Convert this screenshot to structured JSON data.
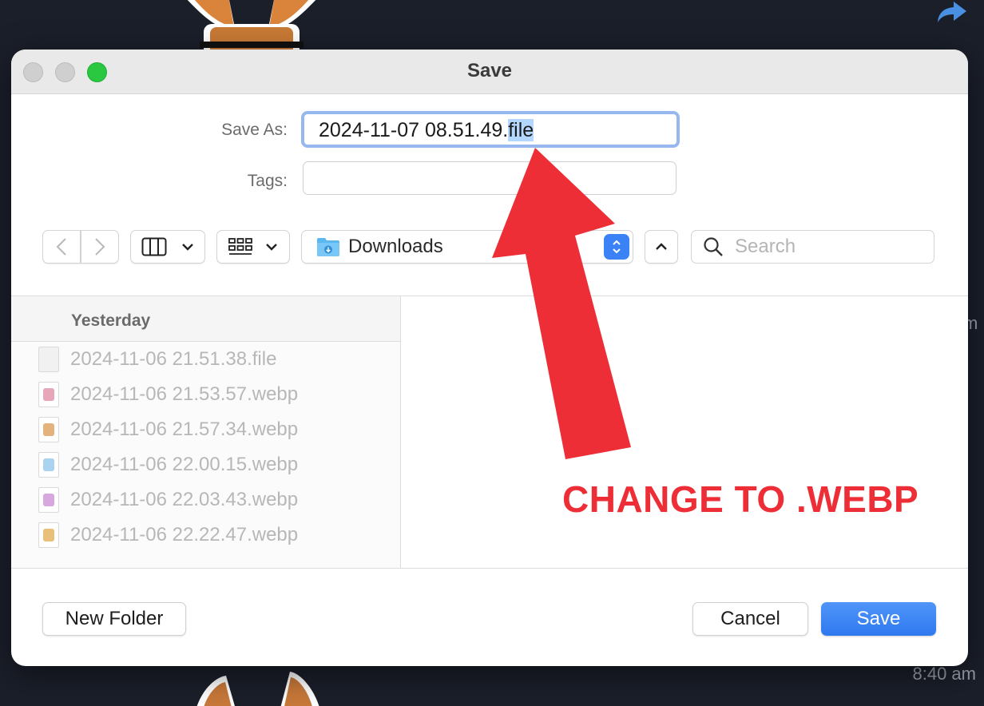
{
  "background": {
    "timestamp": "8:40 am",
    "partial_text": "m"
  },
  "dialog": {
    "title": "Save",
    "save_as_label": "Save As:",
    "file_name": {
      "base": "2024-11-07 08.51.49.",
      "selected": "file"
    },
    "tags_label": "Tags:",
    "location": "Downloads",
    "search_placeholder": "Search",
    "group_header": "Yesterday",
    "files": [
      {
        "name": "2024-11-06 21.51.38.file",
        "icon": "generic-file-icon"
      },
      {
        "name": "2024-11-06 21.53.57.webp",
        "icon": "image-file-icon"
      },
      {
        "name": "2024-11-06 21.57.34.webp",
        "icon": "image-file-icon"
      },
      {
        "name": "2024-11-06 22.00.15.webp",
        "icon": "image-file-icon"
      },
      {
        "name": "2024-11-06 22.03.43.webp",
        "icon": "image-file-icon"
      },
      {
        "name": "2024-11-06 22.22.47.webp",
        "icon": "image-file-icon"
      }
    ],
    "new_folder_label": "New Folder",
    "cancel_label": "Cancel",
    "save_label": "Save"
  },
  "annotation": {
    "text": "CHANGE TO .WEBP",
    "color": "#ee2e36"
  },
  "colors": {
    "accent": "#3b82f6",
    "traffic_zoom": "#2ac840"
  }
}
